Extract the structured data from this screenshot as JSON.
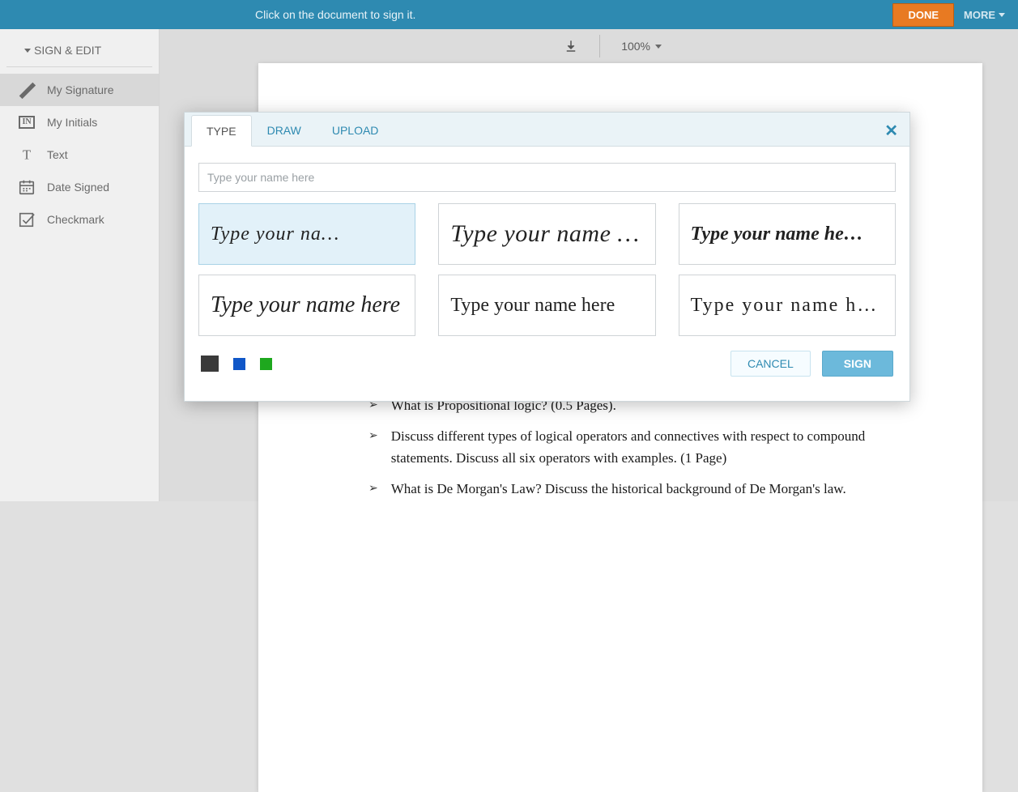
{
  "topbar": {
    "message": "Click on the document to sign it.",
    "done": "DONE",
    "more": "MORE"
  },
  "sidebar": {
    "title": "SIGN & EDIT",
    "items": [
      {
        "label": "My Signature"
      },
      {
        "label": "My Initials"
      },
      {
        "label": "Text"
      },
      {
        "label": "Date Signed"
      },
      {
        "label": "Checkmark"
      }
    ]
  },
  "toolbar": {
    "zoom": "100%"
  },
  "modal": {
    "tabs": {
      "type": "TYPE",
      "draw": "DRAW",
      "upload": "UPLOAD"
    },
    "input_placeholder": "Type your name here",
    "samples": [
      "Type your na…",
      "Type your name here",
      "Type your name he…",
      "Type your name here",
      "Type your name here",
      "Type your name he…"
    ],
    "colors": {
      "black": "#3a3a3a",
      "blue": "#1057c8",
      "green": "#1ea81e"
    },
    "cancel": "CANCEL",
    "sign": "SIGN"
  },
  "document": {
    "items": [
      "What is Propositional logic?  (0.5 Pages).",
      "Discuss different types of logical operators and connectives with respect to compound statements. Discuss all six operators with examples. (1 Page)",
      "What is De Morgan's Law? Discuss the historical background of De Morgan's law."
    ]
  }
}
